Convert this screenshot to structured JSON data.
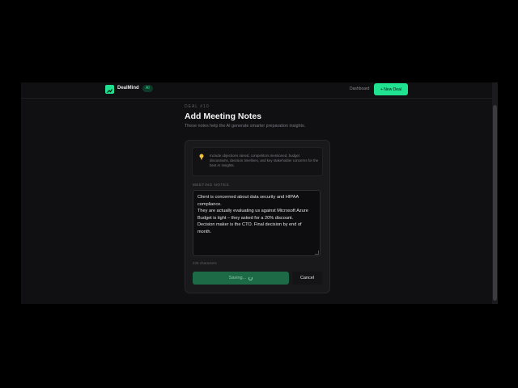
{
  "nav": {
    "brand": "DealMind",
    "ai_badge": "AI",
    "dashboard_link": "Dashboard",
    "new_deal_label": "+ New Deal"
  },
  "header": {
    "deal_id": "DEAL #10",
    "title": "Add Meeting Notes",
    "subtitle": "These notes help the AI generate smarter preparation insights."
  },
  "tip": {
    "icon": "lightbulb-icon",
    "text": "Include objections raised, competitors mentioned, budget discussions, decision timelines, and key stakeholder concerns for the best AI insights."
  },
  "form": {
    "notes_label": "MEETING NOTES",
    "notes_lines": [
      "Client is concerned about data security and HIPAA compliance.",
      "They are actually evaluating us against Microsoft Azure",
      "Budget is tight – they asked for a 20% discount.",
      "Decision maker is the CTO. Final decision by end of month."
    ],
    "char_count": "225 characters",
    "save_label": "Saving...",
    "cancel_label": "Cancel"
  },
  "colors": {
    "accent": "#20e391",
    "background": "#101012",
    "card": "#19191c",
    "save_disabled": "#1d6a47"
  }
}
